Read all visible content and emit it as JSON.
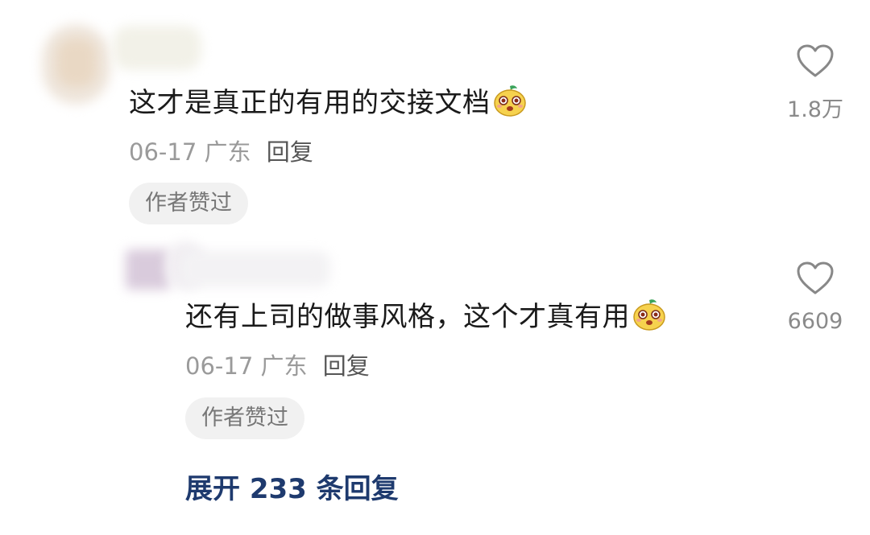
{
  "comments": [
    {
      "text": "这才是真正的有用的交接文档",
      "emoji": "pear-face-emoji",
      "date": "06-17",
      "location": "广东",
      "reply_label": "回复",
      "badge": "作者赞过",
      "like_count": "1.8万"
    },
    {
      "text": "还有上司的做事风格，这个才真有用",
      "emoji": "pear-face-emoji",
      "date": "06-17",
      "location": "广东",
      "reply_label": "回复",
      "badge": "作者赞过",
      "like_count": "6609"
    }
  ],
  "expand_replies": "展开 233 条回复",
  "icons": {
    "like": "heart-outline-icon",
    "emoji": "pear-face-emoji"
  }
}
